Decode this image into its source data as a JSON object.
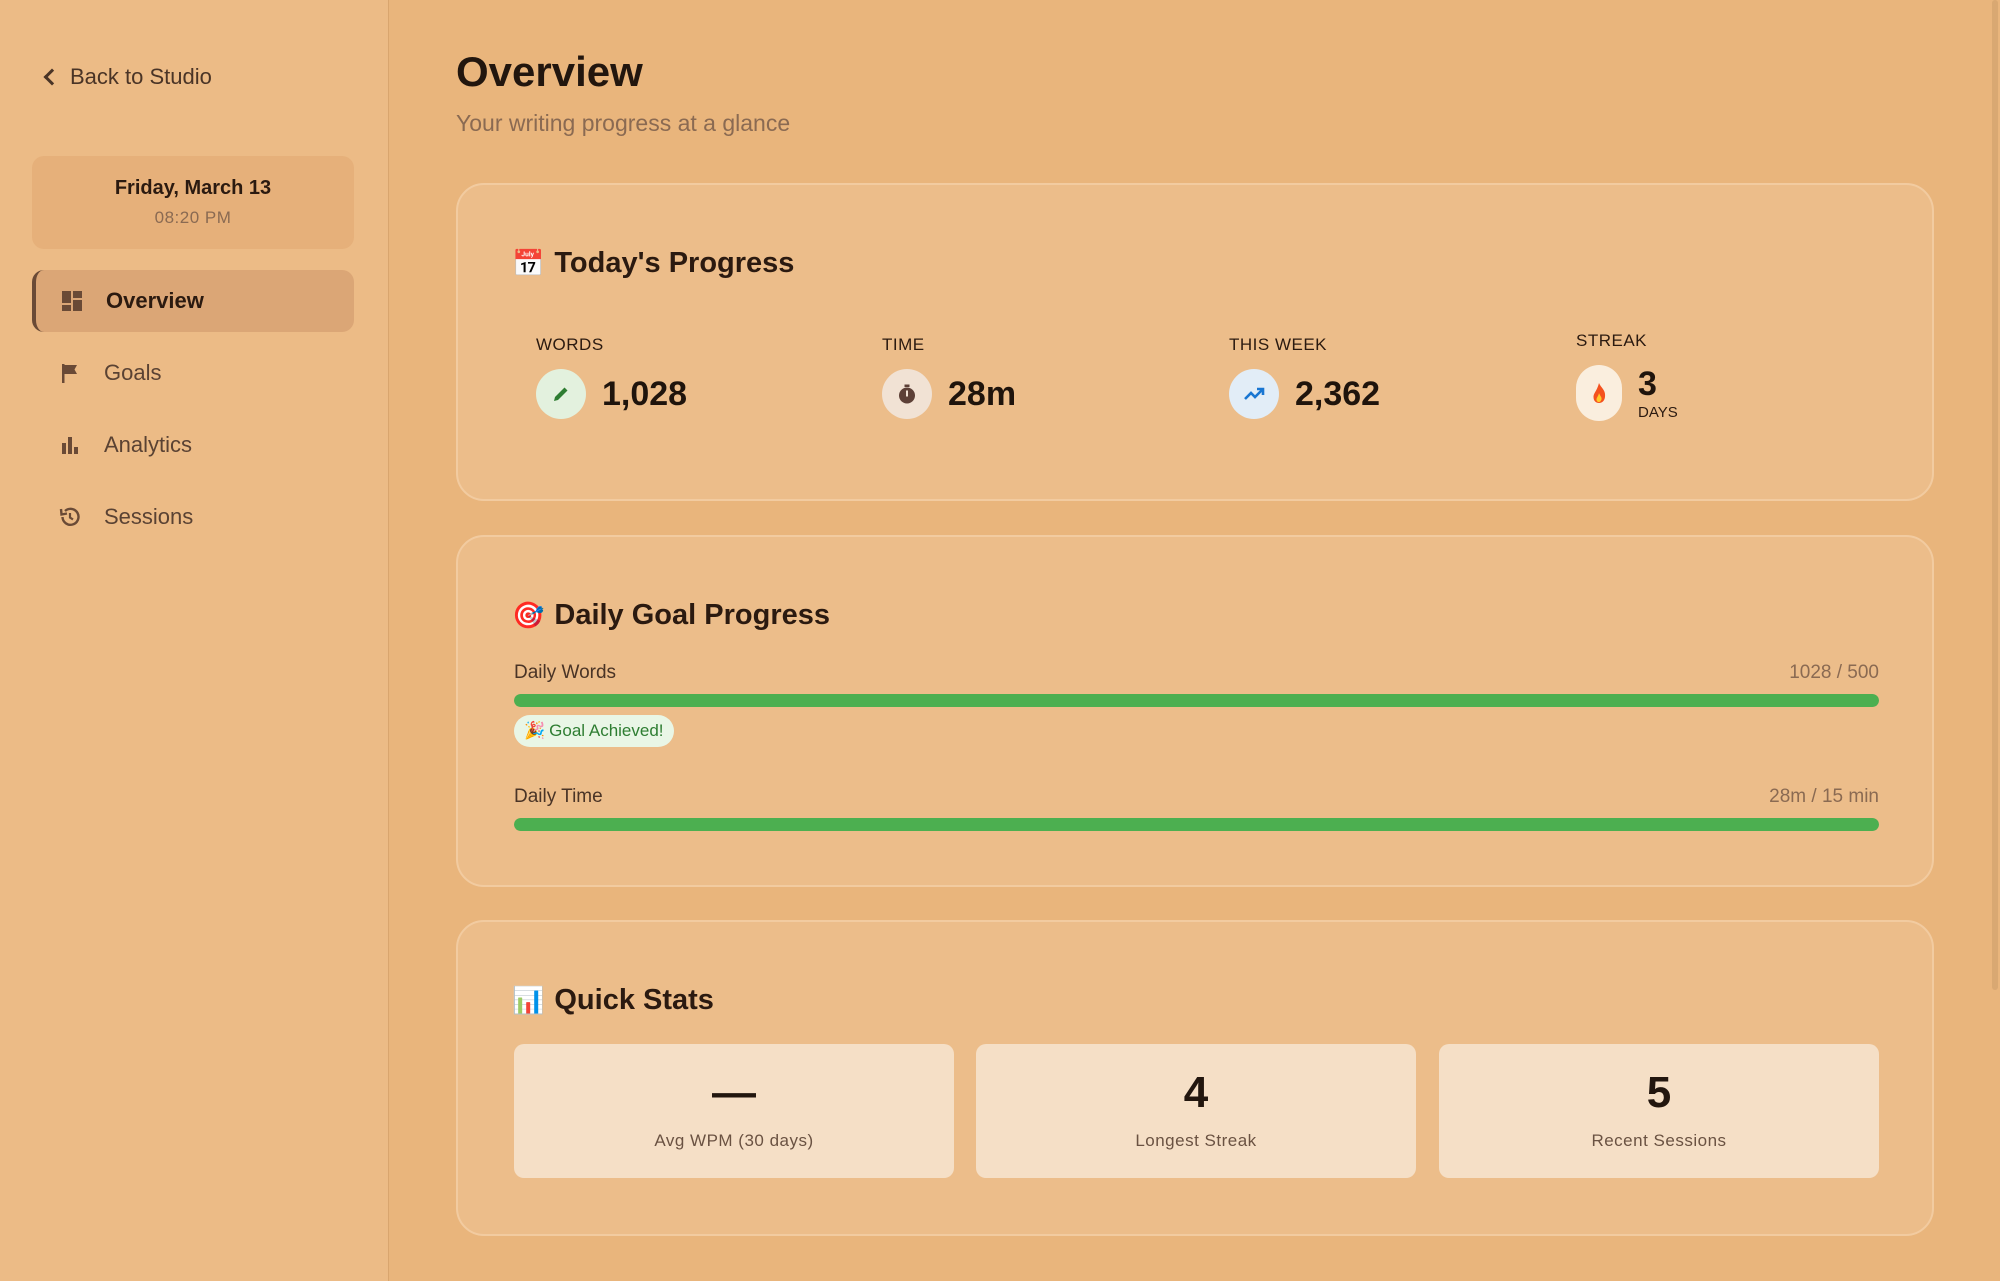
{
  "sidebar": {
    "back_label": "Back to Studio",
    "date": "Friday, March 13",
    "time": "08:20 PM",
    "items": [
      {
        "label": "Overview",
        "icon": "dashboard-icon"
      },
      {
        "label": "Goals",
        "icon": "flag-icon"
      },
      {
        "label": "Analytics",
        "icon": "bar-chart-icon"
      },
      {
        "label": "Sessions",
        "icon": "history-icon"
      }
    ]
  },
  "header": {
    "title": "Overview",
    "subtitle": "Your writing progress at a glance"
  },
  "today": {
    "title": "Today's Progress",
    "icon": "calendar-icon",
    "stats": [
      {
        "label": "WORDS",
        "value": "1,028",
        "icon": "pencil-icon"
      },
      {
        "label": "TIME",
        "value": "28m",
        "icon": "stopwatch-icon"
      },
      {
        "label": "THIS WEEK",
        "value": "2,362",
        "icon": "trending-up-icon"
      },
      {
        "label": "STREAK",
        "value": "3",
        "unit": "DAYS",
        "icon": "fire-icon"
      }
    ]
  },
  "goals": {
    "title": "Daily Goal Progress",
    "icon": "target-icon",
    "words": {
      "label": "Daily Words",
      "ratio": "1028 / 500",
      "progress": 1.0
    },
    "badge": "Goal Achieved!",
    "time": {
      "label": "Daily Time",
      "ratio": "28m / 15 min",
      "progress": 1.0
    }
  },
  "quick": {
    "title": "Quick Stats",
    "icon": "bar-chart-emoji-icon",
    "items": [
      {
        "value": "—",
        "label": "Avg WPM (30 days)"
      },
      {
        "value": "4",
        "label": "Longest Streak"
      },
      {
        "value": "5",
        "label": "Recent Sessions"
      }
    ]
  },
  "colors": {
    "background": "#e9b57c",
    "accent_green": "#4caf50",
    "card": "#ecbd8a"
  }
}
